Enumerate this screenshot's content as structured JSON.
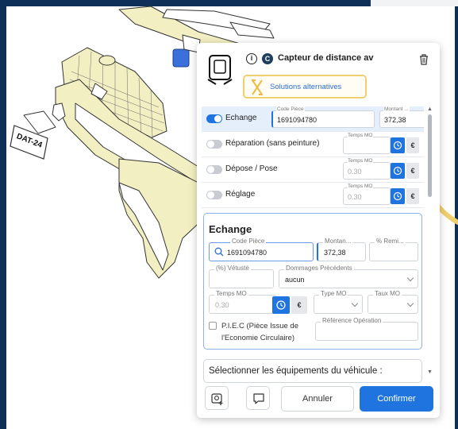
{
  "part": {
    "title": "Capteur de distance av",
    "info_glyph": "i",
    "c_glyph": "C",
    "alternatives_label": "Solutions alternatives"
  },
  "plate": {
    "text": "DAT-24"
  },
  "options": [
    {
      "label": "Echange",
      "active": true,
      "code_label": "Code Pièce",
      "code_value": "1691094780",
      "amount_label": "Montant ...",
      "amount_value": "372,38"
    },
    {
      "label": "Réparation (sans peinture)",
      "time_label": "Temps MO"
    },
    {
      "label": "Dépose / Pose",
      "time_label": "Temps MO",
      "time_value": "0.30"
    },
    {
      "label": "Réglage",
      "time_label": "Temps MO",
      "time_value": "0.30"
    }
  ],
  "euro": "€",
  "detail": {
    "title": "Echange",
    "code_label": "Code Pièce",
    "code_value": "1691094780",
    "amount_label": "Montan...",
    "amount_value": "372,38",
    "discount_label": "% Remi...",
    "vetuste_label": "(%) Vétusté",
    "dommages_label": "Dommages Précédents",
    "dommages_value": "aucun",
    "time_label": "Temps MO",
    "time_value": "0.30",
    "type_label": "Type MO",
    "taux_label": "Taux MO",
    "piec_label": "P.I.E.C (Pièce Issue de l'Economie Circulaire)",
    "ref_label": "Référence Opération"
  },
  "equipment_label": "Sélectionner les équipements du véhicule :",
  "footer": {
    "cancel_label": "Annuler",
    "confirm_label": "Confirmer"
  },
  "colors": {
    "primary": "#1f74e0",
    "highlight_yellow": "#f0cf6e",
    "part_fill": "#f2efc2",
    "selected_part": "#3b6fd9",
    "background_dark": "#0d2f58"
  }
}
